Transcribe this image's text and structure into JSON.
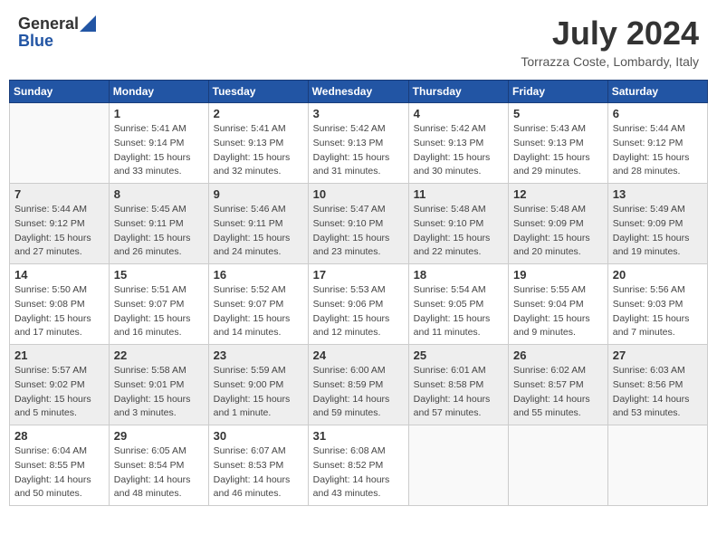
{
  "header": {
    "logo_general": "General",
    "logo_blue": "Blue",
    "month_year": "July 2024",
    "location": "Torrazza Coste, Lombardy, Italy"
  },
  "weekdays": [
    "Sunday",
    "Monday",
    "Tuesday",
    "Wednesday",
    "Thursday",
    "Friday",
    "Saturday"
  ],
  "weeks": [
    [
      {
        "day": "",
        "sunrise": "",
        "sunset": "",
        "daylight": ""
      },
      {
        "day": "1",
        "sunrise": "Sunrise: 5:41 AM",
        "sunset": "Sunset: 9:14 PM",
        "daylight": "Daylight: 15 hours and 33 minutes."
      },
      {
        "day": "2",
        "sunrise": "Sunrise: 5:41 AM",
        "sunset": "Sunset: 9:13 PM",
        "daylight": "Daylight: 15 hours and 32 minutes."
      },
      {
        "day": "3",
        "sunrise": "Sunrise: 5:42 AM",
        "sunset": "Sunset: 9:13 PM",
        "daylight": "Daylight: 15 hours and 31 minutes."
      },
      {
        "day": "4",
        "sunrise": "Sunrise: 5:42 AM",
        "sunset": "Sunset: 9:13 PM",
        "daylight": "Daylight: 15 hours and 30 minutes."
      },
      {
        "day": "5",
        "sunrise": "Sunrise: 5:43 AM",
        "sunset": "Sunset: 9:13 PM",
        "daylight": "Daylight: 15 hours and 29 minutes."
      },
      {
        "day": "6",
        "sunrise": "Sunrise: 5:44 AM",
        "sunset": "Sunset: 9:12 PM",
        "daylight": "Daylight: 15 hours and 28 minutes."
      }
    ],
    [
      {
        "day": "7",
        "sunrise": "Sunrise: 5:44 AM",
        "sunset": "Sunset: 9:12 PM",
        "daylight": "Daylight: 15 hours and 27 minutes."
      },
      {
        "day": "8",
        "sunrise": "Sunrise: 5:45 AM",
        "sunset": "Sunset: 9:11 PM",
        "daylight": "Daylight: 15 hours and 26 minutes."
      },
      {
        "day": "9",
        "sunrise": "Sunrise: 5:46 AM",
        "sunset": "Sunset: 9:11 PM",
        "daylight": "Daylight: 15 hours and 24 minutes."
      },
      {
        "day": "10",
        "sunrise": "Sunrise: 5:47 AM",
        "sunset": "Sunset: 9:10 PM",
        "daylight": "Daylight: 15 hours and 23 minutes."
      },
      {
        "day": "11",
        "sunrise": "Sunrise: 5:48 AM",
        "sunset": "Sunset: 9:10 PM",
        "daylight": "Daylight: 15 hours and 22 minutes."
      },
      {
        "day": "12",
        "sunrise": "Sunrise: 5:48 AM",
        "sunset": "Sunset: 9:09 PM",
        "daylight": "Daylight: 15 hours and 20 minutes."
      },
      {
        "day": "13",
        "sunrise": "Sunrise: 5:49 AM",
        "sunset": "Sunset: 9:09 PM",
        "daylight": "Daylight: 15 hours and 19 minutes."
      }
    ],
    [
      {
        "day": "14",
        "sunrise": "Sunrise: 5:50 AM",
        "sunset": "Sunset: 9:08 PM",
        "daylight": "Daylight: 15 hours and 17 minutes."
      },
      {
        "day": "15",
        "sunrise": "Sunrise: 5:51 AM",
        "sunset": "Sunset: 9:07 PM",
        "daylight": "Daylight: 15 hours and 16 minutes."
      },
      {
        "day": "16",
        "sunrise": "Sunrise: 5:52 AM",
        "sunset": "Sunset: 9:07 PM",
        "daylight": "Daylight: 15 hours and 14 minutes."
      },
      {
        "day": "17",
        "sunrise": "Sunrise: 5:53 AM",
        "sunset": "Sunset: 9:06 PM",
        "daylight": "Daylight: 15 hours and 12 minutes."
      },
      {
        "day": "18",
        "sunrise": "Sunrise: 5:54 AM",
        "sunset": "Sunset: 9:05 PM",
        "daylight": "Daylight: 15 hours and 11 minutes."
      },
      {
        "day": "19",
        "sunrise": "Sunrise: 5:55 AM",
        "sunset": "Sunset: 9:04 PM",
        "daylight": "Daylight: 15 hours and 9 minutes."
      },
      {
        "day": "20",
        "sunrise": "Sunrise: 5:56 AM",
        "sunset": "Sunset: 9:03 PM",
        "daylight": "Daylight: 15 hours and 7 minutes."
      }
    ],
    [
      {
        "day": "21",
        "sunrise": "Sunrise: 5:57 AM",
        "sunset": "Sunset: 9:02 PM",
        "daylight": "Daylight: 15 hours and 5 minutes."
      },
      {
        "day": "22",
        "sunrise": "Sunrise: 5:58 AM",
        "sunset": "Sunset: 9:01 PM",
        "daylight": "Daylight: 15 hours and 3 minutes."
      },
      {
        "day": "23",
        "sunrise": "Sunrise: 5:59 AM",
        "sunset": "Sunset: 9:00 PM",
        "daylight": "Daylight: 15 hours and 1 minute."
      },
      {
        "day": "24",
        "sunrise": "Sunrise: 6:00 AM",
        "sunset": "Sunset: 8:59 PM",
        "daylight": "Daylight: 14 hours and 59 minutes."
      },
      {
        "day": "25",
        "sunrise": "Sunrise: 6:01 AM",
        "sunset": "Sunset: 8:58 PM",
        "daylight": "Daylight: 14 hours and 57 minutes."
      },
      {
        "day": "26",
        "sunrise": "Sunrise: 6:02 AM",
        "sunset": "Sunset: 8:57 PM",
        "daylight": "Daylight: 14 hours and 55 minutes."
      },
      {
        "day": "27",
        "sunrise": "Sunrise: 6:03 AM",
        "sunset": "Sunset: 8:56 PM",
        "daylight": "Daylight: 14 hours and 53 minutes."
      }
    ],
    [
      {
        "day": "28",
        "sunrise": "Sunrise: 6:04 AM",
        "sunset": "Sunset: 8:55 PM",
        "daylight": "Daylight: 14 hours and 50 minutes."
      },
      {
        "day": "29",
        "sunrise": "Sunrise: 6:05 AM",
        "sunset": "Sunset: 8:54 PM",
        "daylight": "Daylight: 14 hours and 48 minutes."
      },
      {
        "day": "30",
        "sunrise": "Sunrise: 6:07 AM",
        "sunset": "Sunset: 8:53 PM",
        "daylight": "Daylight: 14 hours and 46 minutes."
      },
      {
        "day": "31",
        "sunrise": "Sunrise: 6:08 AM",
        "sunset": "Sunset: 8:52 PM",
        "daylight": "Daylight: 14 hours and 43 minutes."
      },
      {
        "day": "",
        "sunrise": "",
        "sunset": "",
        "daylight": ""
      },
      {
        "day": "",
        "sunrise": "",
        "sunset": "",
        "daylight": ""
      },
      {
        "day": "",
        "sunrise": "",
        "sunset": "",
        "daylight": ""
      }
    ]
  ]
}
